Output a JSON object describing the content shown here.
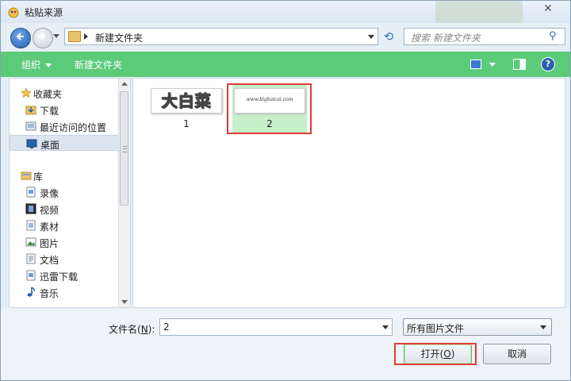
{
  "window": {
    "title": "粘贴来源",
    "close_label": "✕"
  },
  "address": {
    "breadcrumb": "新建文件夹",
    "search_placeholder": "搜索 新建文件夹"
  },
  "toolbar": {
    "organize_label": "组织",
    "new_folder_label": "新建文件夹"
  },
  "nav": {
    "favorites_label": "收藏夹",
    "favorites": [
      {
        "label": "下载",
        "icon": "download-folder-icon"
      },
      {
        "label": "最近访问的位置",
        "icon": "recent-places-icon"
      },
      {
        "label": "桌面",
        "icon": "desktop-icon",
        "selected": true
      }
    ],
    "libraries_label": "库",
    "libraries": [
      {
        "label": "录像",
        "icon": "recordings-library-icon"
      },
      {
        "label": "视频",
        "icon": "video-library-icon"
      },
      {
        "label": "素材",
        "icon": "materials-library-icon"
      },
      {
        "label": "图片",
        "icon": "pictures-library-icon"
      },
      {
        "label": "文档",
        "icon": "documents-library-icon"
      },
      {
        "label": "迅雷下载",
        "icon": "thunder-download-library-icon"
      },
      {
        "label": "音乐",
        "icon": "music-library-icon"
      }
    ]
  },
  "files": [
    {
      "name": "1",
      "thumb_text": "大白菜",
      "selected": false
    },
    {
      "name": "2",
      "thumb_text": "www.bigbaicai.com",
      "selected": true
    }
  ],
  "footer": {
    "filename_label": "文件名(",
    "filename_key": "N",
    "filename_suffix": "):",
    "filename_value": "2",
    "filetype_value": "所有图片文件",
    "open_label": "打开(",
    "open_key": "O",
    "open_suffix": ")",
    "cancel_label": "取消"
  },
  "colors": {
    "toolbar": "#5bcb7a",
    "selection": "#c5f0c8",
    "highlight_box": "#e03b34"
  }
}
